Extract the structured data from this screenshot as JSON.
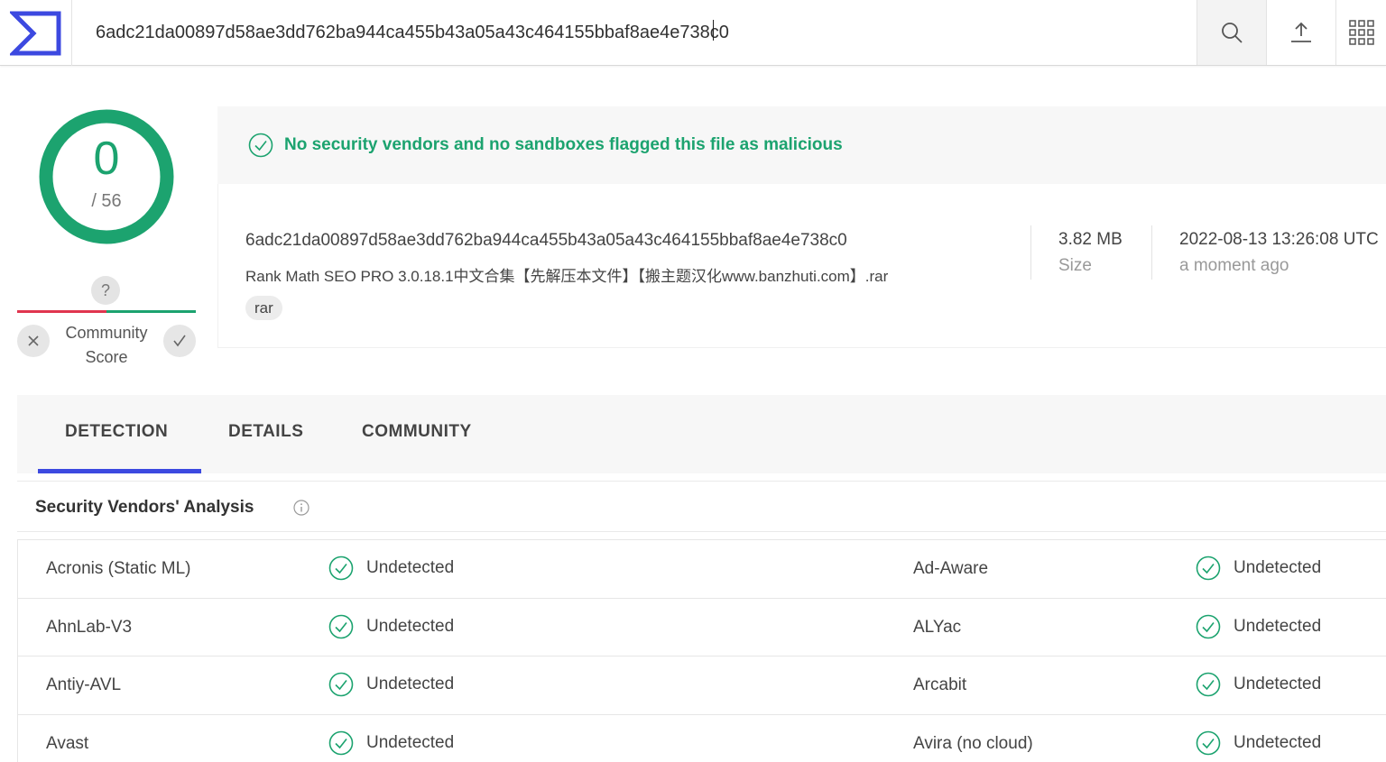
{
  "search": {
    "value": "6adc21da00897d58ae3dd762ba944ca455b43a05a43c464155bbaf8ae4e738c0"
  },
  "score": {
    "detections": "0",
    "total": "/ 56"
  },
  "community": {
    "question": "?",
    "label_line1": "Community",
    "label_line2": "Score"
  },
  "banner": {
    "text": "No security vendors and no sandboxes flagged this file as malicious"
  },
  "file": {
    "hash": "6adc21da00897d58ae3dd762ba944ca455b43a05a43c464155bbaf8ae4e738c0",
    "name": "Rank Math SEO PRO 3.0.18.1中文合集【先解压本文件】【搬主题汉化www.banzhuti.com】.rar",
    "tag": "rar",
    "size": "3.82 MB",
    "size_label": "Size",
    "date": "2022-08-13 13:26:08 UTC",
    "date_label": "a moment ago"
  },
  "tabs": [
    "DETECTION",
    "DETAILS",
    "COMMUNITY"
  ],
  "section": {
    "title": "Security Vendors' Analysis"
  },
  "vendors": [
    {
      "left": "Acronis (Static ML)",
      "left_status": "Undetected",
      "right": "Ad-Aware",
      "right_status": "Undetected"
    },
    {
      "left": "AhnLab-V3",
      "left_status": "Undetected",
      "right": "ALYac",
      "right_status": "Undetected"
    },
    {
      "left": "Antiy-AVL",
      "left_status": "Undetected",
      "right": "Arcabit",
      "right_status": "Undetected"
    },
    {
      "left": "Avast",
      "left_status": "Undetected",
      "right": "Avira (no cloud)",
      "right_status": "Undetected"
    }
  ],
  "colors": {
    "accent": "#3c49e0",
    "clean": "#1ca36f",
    "danger": "#e0354f"
  },
  "icons": [
    "virustotal-logo-icon",
    "search-icon",
    "upload-icon",
    "apps-grid-icon",
    "check-circle-icon",
    "close-icon",
    "check-icon",
    "info-icon"
  ]
}
